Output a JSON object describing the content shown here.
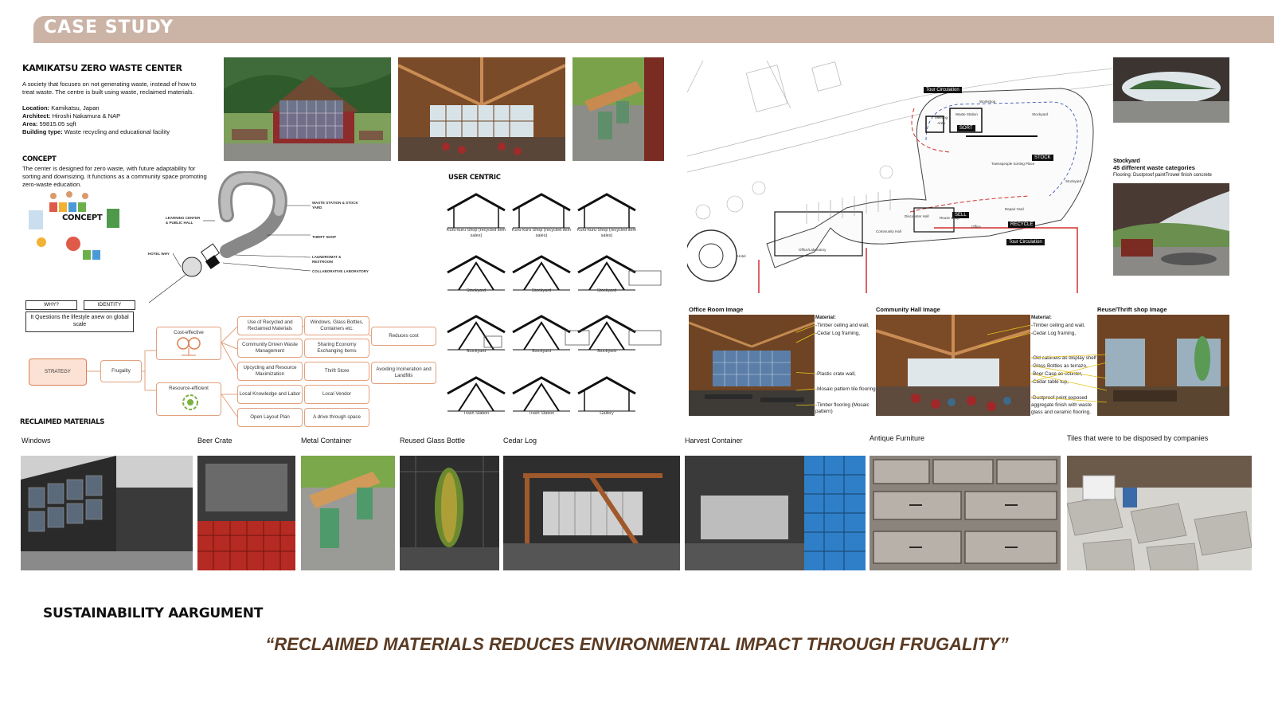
{
  "banner": {
    "title": "CASE STUDY"
  },
  "project": {
    "title": "KAMIKATSU ZERO WASTE CENTER",
    "description": "A society that focuses on not generating waste, instead of how to treat waste. The centre is built using waste, reclaimed materials.",
    "facts": [
      {
        "label": "Location:",
        "value": "Kamikatsu, Japan"
      },
      {
        "label": "Architect:",
        "value": "Hiroshi Nakamura & NAP"
      },
      {
        "label": "Area:",
        "value": "59815.05 sqft"
      },
      {
        "label": "Building type:",
        "value": "Waste recycling and educational facility"
      }
    ]
  },
  "concept": {
    "heading": "CONCEPT",
    "text": "The center is designed for zero waste, with future adaptability for sorting and downsizing. It functions as a community space promoting zero-waste education.",
    "badge": "CONCEPT"
  },
  "diagram": {
    "labels": [
      "WASTE STATION & STOCK YARD",
      "THRIFT SHOP",
      "LAUNDROMAT & RESTROOM",
      "COLLABORATIVE LABORATORY",
      "LEARNING CENTER & PUBLIC HALL",
      "HOTEL WHY"
    ],
    "why": "WHY?",
    "identity": "IDENTITY",
    "question": "It Questions the lifestyle anew on global scale"
  },
  "strategy": {
    "root": "STRATEGY",
    "frugality": "Frugality",
    "cost_effective": "Cost-effective",
    "resource_efficient": "Resource-efficient",
    "items_left": [
      "Use of Recycled and Reclaimed Materials",
      "Community Driven Waste Management",
      "Upcycling and Resource Maximization",
      "Local Knowledge and Labor",
      "Open Layout Plan"
    ],
    "items_right": [
      "Windows, Glass Bottles, Containers etc.",
      "Sharing Economy Exchanging Items",
      "Thrift Store",
      "Local Vendor",
      "A drive through space"
    ],
    "outcomes": [
      "Reduces cost",
      "Avoiding Incineration and Landfills"
    ]
  },
  "user_centric": {
    "heading": "USER CENTRIC",
    "rows": [
      [
        "Kuru-kuru Shop (recycled item sales)",
        "Kuru-kuru Shop (recycled item sales)",
        "Kuru-kuru Shop (recycled item sales)"
      ],
      [
        "Stockyard",
        "Stockyard",
        "Stockyard"
      ],
      [
        "Stockyard",
        "Stockyard",
        "Stockyard"
      ],
      [
        "Trash Station",
        "Trash Station",
        "Gallery"
      ]
    ]
  },
  "plan": {
    "tags": [
      "Tour Circulation",
      "SORT",
      "STOCK",
      "SELL",
      "RECYCLE",
      "Tour Circulation"
    ],
    "labels": [
      "Workshop",
      "Waste Station",
      "Meeting Area",
      "Stockyard",
      "Townspeople Sorting Place",
      "Stockyard",
      "Repair Yard",
      "Reuse Shop",
      "Community Hall",
      "Discounter Hall",
      "Office",
      "Office/Laboratory",
      "Hotel"
    ]
  },
  "stockyard": {
    "title": "Stockyard",
    "subtitle": "45 different waste categories",
    "note": "Flooring: Dustproof paintTrowel finish concrete"
  },
  "interior": {
    "office_title": "Office Room Image",
    "hall_title": "Community Hall Image",
    "reuse_title": "Reuse/Thrift shop Image",
    "material_label": "Material:",
    "office_materials": [
      "-Timber ceiling and wall,",
      "-Cedar Log framing,",
      "-Plastic crate wall,",
      "-Mosaic pattern tile flooring",
      "-Timber flooring (Mosaic pattern)"
    ],
    "hall_materials": [
      "-Timber ceiling and wall,",
      "-Cedar Log framing,",
      "-Old cabinets as display shelf",
      "-Glass Bottles as terrazo,",
      "-Beer Case as counter,",
      "-Cedar table top,",
      "-Dustproof paint exposed aggregate finish with waste glass and ceramic flooring."
    ]
  },
  "reclaimed": {
    "heading": "RECLAIMED MATERIALS",
    "items": [
      "Windows",
      "Beer Crate",
      "Metal Container",
      "Reused Glass Bottle",
      "Cedar Log",
      "Harvest Container",
      "Antique Furniture",
      "Tiles that were to be disposed by companies"
    ]
  },
  "sustainability": {
    "heading": "SUSTAINABILITY AARGUMENT",
    "quote": "“RECLAIMED MATERIALS REDUCES ENVIRONMENTAL IMPACT THROUGH FRUGALITY”"
  }
}
